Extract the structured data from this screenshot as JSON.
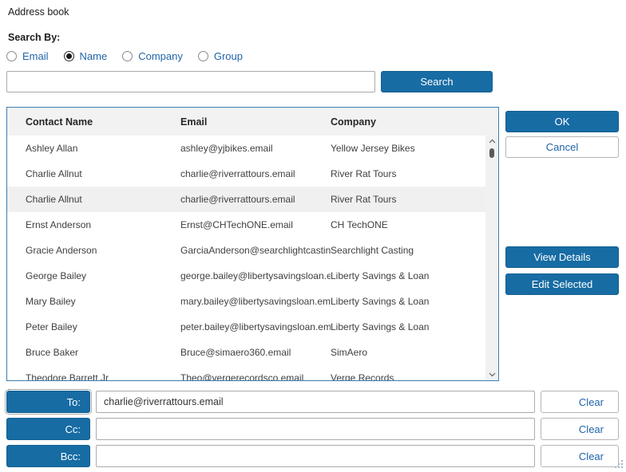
{
  "title": "Address book",
  "search": {
    "label": "Search By:",
    "options": [
      {
        "label": "Email",
        "selected": false
      },
      {
        "label": "Name",
        "selected": true
      },
      {
        "label": "Company",
        "selected": false
      },
      {
        "label": "Group",
        "selected": false
      }
    ],
    "input_value": "",
    "button_label": "Search"
  },
  "table": {
    "columns": [
      "Contact Name",
      "Email",
      "Company"
    ],
    "selected_row_index": 2,
    "rows": [
      [
        "Ashley Allan",
        "ashley@yjbikes.email",
        "Yellow Jersey Bikes"
      ],
      [
        "Charlie Allnut",
        "charlie@riverrattours.email",
        "River Rat Tours"
      ],
      [
        "Charlie Allnut",
        "charlie@riverrattours.email",
        "River Rat Tours"
      ],
      [
        "Ernst Anderson",
        "Ernst@CHTechONE.email",
        "CH TechONE"
      ],
      [
        "Gracie Anderson",
        "GarciaAnderson@searchlightcasting.email",
        "Searchlight Casting"
      ],
      [
        "George Bailey",
        "george.bailey@libertysavingsloan.email",
        "Liberty Savings & Loan"
      ],
      [
        "Mary Bailey",
        "mary.bailey@libertysavingsloan.email",
        "Liberty Savings & Loan"
      ],
      [
        "Peter Bailey",
        "peter.bailey@libertysavingsloan.email",
        "Liberty Savings & Loan"
      ],
      [
        "Bruce Baker",
        "Bruce@simaero360.email",
        "SimAero"
      ],
      [
        "Theodore Barrett Jr",
        "Theo@vergerecordsco.email",
        "Verge Records"
      ]
    ]
  },
  "actions": {
    "ok": "OK",
    "cancel": "Cancel",
    "view_details": "View Details",
    "edit_selected": "Edit Selected"
  },
  "recipients": {
    "rows": [
      {
        "label": "To:",
        "value": "charlie@riverrattours.email",
        "clear_label": "Clear"
      },
      {
        "label": "Cc:",
        "value": "",
        "clear_label": "Clear"
      },
      {
        "label": "Bcc:",
        "value": "",
        "clear_label": "Clear"
      }
    ]
  },
  "colors": {
    "primary_blue": "#176ca4",
    "link_blue": "#2164a8",
    "table_border": "#3c7fb1",
    "header_bg": "#f2f2f2",
    "selected_row_bg": "#f0f0f0",
    "input_border": "#ababab",
    "scrollbar_thumb": "#5a5a5a"
  }
}
